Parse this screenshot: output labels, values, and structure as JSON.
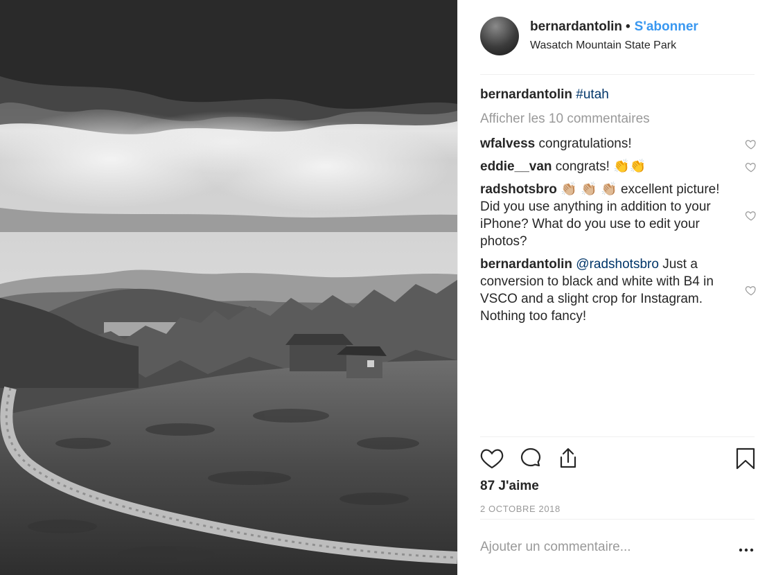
{
  "post": {
    "photo_alt": "Black and white landscape: cabin on a hill under storm clouds, winding road, mountains"
  },
  "header": {
    "username": "bernardantolin",
    "separator": "•",
    "follow_label": "S'abonner",
    "location": "Wasatch Mountain State Park"
  },
  "caption": {
    "username": "bernardantolin",
    "hashtag": "#utah"
  },
  "view_all_label": "Afficher les 10 commentaires",
  "comments": [
    {
      "username": "wfalvess",
      "text": "congratulations!"
    },
    {
      "username": "eddie__van",
      "text": "congrats! 👏👏"
    },
    {
      "username": "radshotsbro",
      "text": "👏🏼 👏🏼 👏🏼 excellent picture! Did you use anything in addition to your iPhone? What do you use to edit your photos?"
    },
    {
      "username": "bernardantolin",
      "mention": "@radshotsbro",
      "text": "Just a conversion to black and white with B4 in VSCO and a slight crop for Instagram. Nothing too fancy!"
    }
  ],
  "actions": {
    "like_icon": "heart-icon",
    "comment_icon": "speech-bubble-icon",
    "share_icon": "share-icon",
    "save_icon": "bookmark-icon"
  },
  "likes_label": "87 J'aime",
  "date_label": "2 OCTOBRE 2018",
  "add_comment": {
    "placeholder": "Ajouter un commentaire..."
  },
  "colors": {
    "accent": "#3897f0",
    "link": "#003569",
    "text": "#262626",
    "muted": "#999999",
    "divider": "#efefef"
  }
}
